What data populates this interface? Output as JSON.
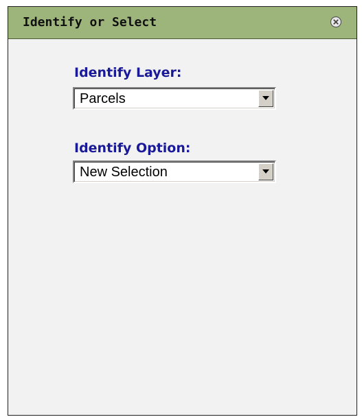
{
  "panel": {
    "title": "Identify or Select",
    "close_icon": "close-circle-icon"
  },
  "identify_layer": {
    "label": "Identify Layer:",
    "selected": "Parcels"
  },
  "identify_option": {
    "label": "Identify Option:",
    "selected": "New Selection"
  },
  "colors": {
    "titlebar": "#9db57a",
    "label": "#1a1a99",
    "panel_bg": "#f2f2f2"
  }
}
